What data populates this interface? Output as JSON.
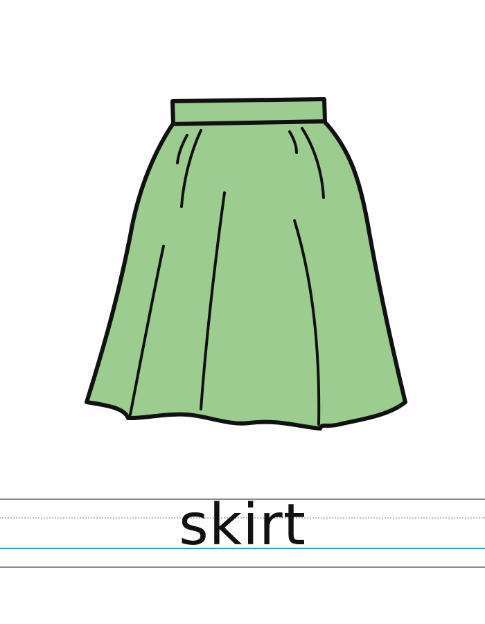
{
  "card": {
    "word": "skirt",
    "illustration_icon": "skirt-icon"
  },
  "colors": {
    "skirt_fill": "#9ccc8f",
    "outline": "#111111",
    "guide_line": "#8a8a8a",
    "midline_dotted": "#bdbdbd",
    "baseline": "#2e9ad6"
  }
}
